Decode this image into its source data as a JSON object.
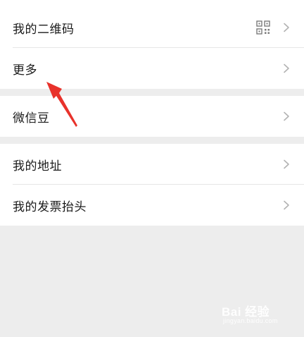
{
  "groups": [
    {
      "items": [
        {
          "label": "我的二维码",
          "icon": "qr-code-icon"
        },
        {
          "label": "更多"
        }
      ]
    },
    {
      "items": [
        {
          "label": "微信豆"
        }
      ]
    },
    {
      "items": [
        {
          "label": "我的地址"
        },
        {
          "label": "我的发票抬头"
        }
      ]
    }
  ],
  "watermark": {
    "main": "Bai 经验",
    "sub": "jingyan.baidu.com"
  },
  "colors": {
    "background": "#ededed",
    "row_background": "#ffffff",
    "text": "#1a1a1a",
    "chevron": "#b2b2b2",
    "annotation_arrow": "#e8322b"
  }
}
